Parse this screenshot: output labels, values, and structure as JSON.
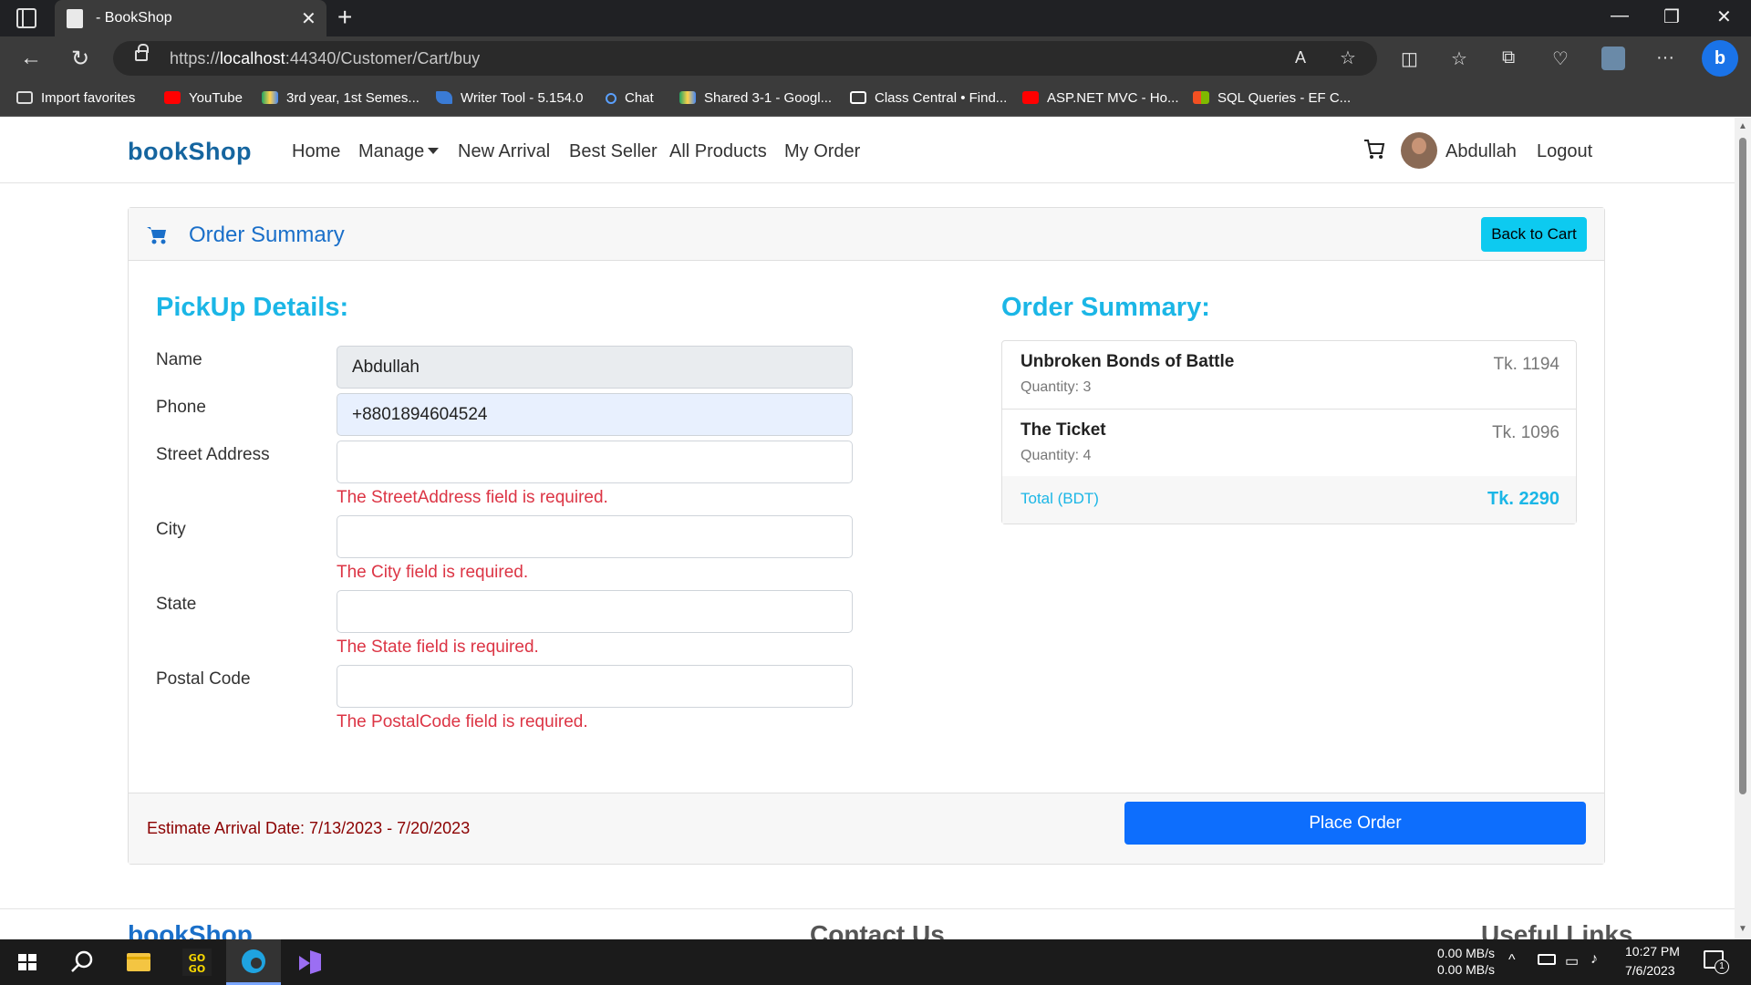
{
  "browser": {
    "tab_title": "- BookShop",
    "url_prefix": "https://",
    "url_host": "localhost",
    "url_rest": ":44340/Customer/Cart/buy",
    "bookmarks": [
      {
        "label": "Import favorites"
      },
      {
        "label": "YouTube"
      },
      {
        "label": "3rd year, 1st Semes..."
      },
      {
        "label": "Writer Tool - 5.154.0"
      },
      {
        "label": "Chat"
      },
      {
        "label": "Shared 3-1 - Googl..."
      },
      {
        "label": "Class Central • Find..."
      },
      {
        "label": "ASP.NET MVC - Ho..."
      },
      {
        "label": "SQL Queries - EF C..."
      }
    ]
  },
  "nav": {
    "brand": "bookShop",
    "links": [
      "Home",
      "Manage",
      "New Arrival",
      "Best Seller",
      "All Products",
      "My Order"
    ],
    "user": "Abdullah",
    "logout": "Logout"
  },
  "card": {
    "title": "Order Summary",
    "back_label": "Back to Cart",
    "pickup_title": "PickUp Details:",
    "summary_title": "Order Summary:"
  },
  "form": {
    "name_label": "Name",
    "name_value": "Abdullah",
    "phone_label": "Phone",
    "phone_value": "+8801894604524",
    "street_label": "Street Address",
    "street_error": "The StreetAddress field is required.",
    "city_label": "City",
    "city_error": "The City field is required.",
    "state_label": "State",
    "state_error": "The State field is required.",
    "postal_label": "Postal Code",
    "postal_error": "The PostalCode field is required."
  },
  "order": {
    "items": [
      {
        "title": "Unbroken Bonds of Battle",
        "quantity": "Quantity: 3",
        "price": "Tk. 1194"
      },
      {
        "title": "The Ticket",
        "quantity": "Quantity: 4",
        "price": "Tk. 1096"
      }
    ],
    "total_label": "Total (BDT)",
    "total_value": "Tk. 2290"
  },
  "footer_bar": {
    "eta": "Estimate Arrival Date: 7/13/2023 - 7/20/2023",
    "place_order": "Place Order"
  },
  "site_footer": {
    "brand": "bookShop",
    "contact": "Contact Us",
    "links": "Useful Links"
  },
  "taskbar": {
    "net_up": "0.00 MB/s",
    "net_down": "0.00 MB/s",
    "time": "10:27 PM",
    "date": "7/6/2023",
    "notif_count": "1"
  },
  "colors": {
    "accent_cyan": "#1bb6e6",
    "primary_blue": "#0d6efd",
    "error_red": "#dc3545",
    "brand_blue": "#15659f"
  }
}
